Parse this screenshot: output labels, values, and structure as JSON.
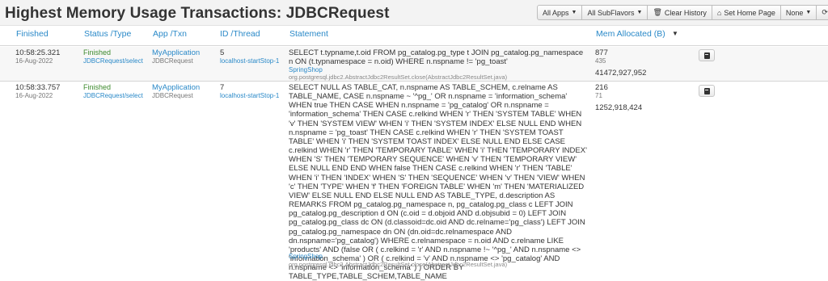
{
  "page_title": "Highest Memory Usage Transactions: JDBCRequest",
  "toolbar": {
    "all_apps": "All Apps",
    "all_subflavors": "All SubFlavors",
    "clear_history": "Clear History",
    "set_home_page": "Set Home Page",
    "none": "None"
  },
  "columns": {
    "finished": "Finished",
    "status_type": "Status /Type",
    "app_txn": "App /Txn",
    "id_thread": "ID /Thread",
    "statement": "Statement",
    "mem_allocated": "Mem Allocated (B)"
  },
  "rows": [
    {
      "time": "10:58:25.321",
      "date": "16-Aug-2022",
      "status": "Finished",
      "type": "JDBCRequest/select",
      "app": "MyApplication",
      "txn": "JDBCRequest",
      "id": "5",
      "thread": "localhost-startStop-1",
      "statement": "SELECT t.typname,t.oid FROM pg_catalog.pg_type t JOIN pg_catalog.pg_namespace n ON (t.typnamespace = n.oid) WHERE n.nspname != 'pg_toast'",
      "statement_app": "SpringShop",
      "statement_source": "org.postgresql.jdbc2.AbstractJdbc2ResultSet.close(AbstractJdbc2ResultSet.java)",
      "mem_main": "877",
      "mem_sub": "435",
      "mem_total": "41472,927,952"
    },
    {
      "time": "10:58:33.757",
      "date": "16-Aug-2022",
      "status": "Finished",
      "type": "JDBCRequest/select",
      "app": "MyApplication",
      "txn": "JDBCRequest",
      "id": "7",
      "thread": "localhost-startStop-1",
      "statement": "SELECT NULL AS TABLE_CAT, n.nspname AS TABLE_SCHEM, c.relname AS TABLE_NAME, CASE n.nspname ~ '^pg_' OR n.nspname = 'information_schema' WHEN true THEN CASE WHEN n.nspname = 'pg_catalog' OR n.nspname = 'information_schema' THEN CASE c.relkind WHEN 'r' THEN 'SYSTEM TABLE' WHEN 'v' THEN 'SYSTEM VIEW' WHEN 'i' THEN 'SYSTEM INDEX' ELSE NULL END WHEN n.nspname = 'pg_toast' THEN CASE c.relkind WHEN 'r' THEN 'SYSTEM TOAST TABLE' WHEN 'i' THEN 'SYSTEM TOAST INDEX' ELSE NULL END ELSE CASE c.relkind WHEN 'r' THEN 'TEMPORARY TABLE' WHEN 'i' THEN 'TEMPORARY INDEX' WHEN 'S' THEN 'TEMPORARY SEQUENCE' WHEN 'v' THEN 'TEMPORARY VIEW' ELSE NULL END END WHEN false THEN CASE c.relkind WHEN 'r' THEN 'TABLE' WHEN 'i' THEN 'INDEX' WHEN 'S' THEN 'SEQUENCE' WHEN 'v' THEN 'VIEW' WHEN 'c' THEN 'TYPE' WHEN 'f' THEN 'FOREIGN TABLE' WHEN 'm' THEN 'MATERIALIZED VIEW' ELSE NULL END ELSE NULL END AS TABLE_TYPE, d.description AS REMARKS FROM pg_catalog.pg_namespace n, pg_catalog.pg_class c LEFT JOIN pg_catalog.pg_description d ON (c.oid = d.objoid AND d.objsubid = 0) LEFT JOIN pg_catalog.pg_class dc ON (d.classoid=dc.oid AND dc.relname='pg_class') LEFT JOIN pg_catalog.pg_namespace dn ON (dn.oid=dc.relnamespace AND dn.nspname='pg_catalog') WHERE c.relnamespace = n.oid AND c.relname LIKE 'products' AND (false OR ( c.relkind = 'r' AND n.nspname !~ '^pg_' AND n.nspname <> 'information_schema' ) OR ( c.relkind = 'v' AND n.nspname <> 'pg_catalog' AND n.nspname <> 'information_schema' ) ) ORDER BY TABLE_TYPE,TABLE_SCHEM,TABLE_NAME",
      "statement_app": "SpringShop",
      "statement_source": "org.postgresql.jdbc2.AbstractJdbc2ResultSet.close(AbstractJdbc2ResultSet.java)",
      "mem_main": "216",
      "mem_sub": "71",
      "mem_total": "1252,918,424"
    }
  ]
}
